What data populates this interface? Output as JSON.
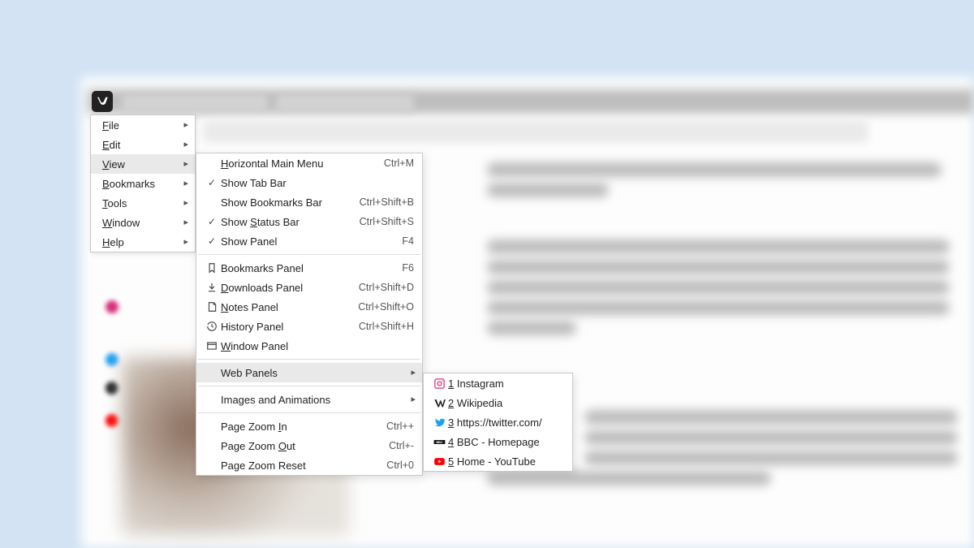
{
  "main_menu": {
    "items": [
      {
        "label": "File",
        "acc_index": 0,
        "has_sub": true
      },
      {
        "label": "Edit",
        "acc_index": 0,
        "has_sub": true
      },
      {
        "label": "View",
        "acc_index": 0,
        "has_sub": true
      },
      {
        "label": "Bookmarks",
        "acc_index": 0,
        "has_sub": true
      },
      {
        "label": "Tools",
        "acc_index": 0,
        "has_sub": true
      },
      {
        "label": "Window",
        "acc_index": 0,
        "has_sub": true
      },
      {
        "label": "Help",
        "acc_index": 0,
        "has_sub": true
      }
    ],
    "highlighted_index": 2
  },
  "view_menu": {
    "sections": [
      [
        {
          "label": "Horizontal Main Menu",
          "acc_index": 0,
          "shortcut": "Ctrl+M",
          "icon": ""
        },
        {
          "label": "Show Tab Bar",
          "icon": "check"
        },
        {
          "label": "Show Bookmarks Bar",
          "shortcut": "Ctrl+Shift+B",
          "icon": ""
        },
        {
          "label": "Show Status Bar",
          "acc_index": 5,
          "shortcut": "Ctrl+Shift+S",
          "icon": "check"
        },
        {
          "label": "Show Panel",
          "shortcut": "F4",
          "icon": "check"
        }
      ],
      [
        {
          "label": "Bookmarks Panel",
          "shortcut": "F6",
          "icon": "bookmark"
        },
        {
          "label": "Downloads Panel",
          "acc_index": 0,
          "shortcut": "Ctrl+Shift+D",
          "icon": "download"
        },
        {
          "label": "Notes Panel",
          "acc_index": 0,
          "shortcut": "Ctrl+Shift+O",
          "icon": "note"
        },
        {
          "label": "History Panel",
          "shortcut": "Ctrl+Shift+H",
          "icon": "history"
        },
        {
          "label": "Window Panel",
          "acc_index": 0,
          "icon": "window"
        }
      ],
      [
        {
          "label": "Web Panels",
          "has_sub": true,
          "highlighted": true
        }
      ],
      [
        {
          "label": "Images and Animations",
          "has_sub": true
        }
      ],
      [
        {
          "label": "Page Zoom In",
          "acc_index": 10,
          "shortcut": "Ctrl++"
        },
        {
          "label": "Page Zoom Out",
          "acc_index": 10,
          "shortcut": "Ctrl+-"
        },
        {
          "label": "Page Zoom Reset",
          "shortcut": "Ctrl+0"
        }
      ]
    ]
  },
  "web_panels_menu": {
    "items": [
      {
        "label": "Instagram",
        "num": "1",
        "icon": "instagram",
        "color": "#d62f7b"
      },
      {
        "label": "Wikipedia",
        "num": "2",
        "icon": "wikipedia",
        "color": "#222"
      },
      {
        "label": "https://twitter.com/",
        "num": "3",
        "icon": "twitter",
        "color": "#1da1f2"
      },
      {
        "label": "BBC - Homepage",
        "num": "4",
        "icon": "bbc",
        "color": "#111"
      },
      {
        "label": "Home - YouTube",
        "num": "5",
        "icon": "youtube",
        "color": "#ff0000"
      }
    ]
  }
}
